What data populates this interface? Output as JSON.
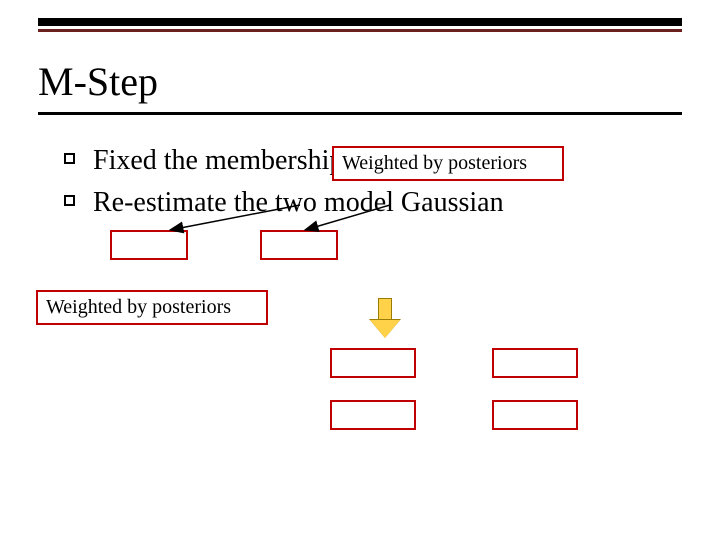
{
  "title": "M-Step",
  "bullets": [
    "Fixed the membership",
    "Re-estimate the two model Gaussian"
  ],
  "callouts": {
    "top_right": "Weighted by posteriors",
    "mid_left": "Weighted by posteriors"
  }
}
